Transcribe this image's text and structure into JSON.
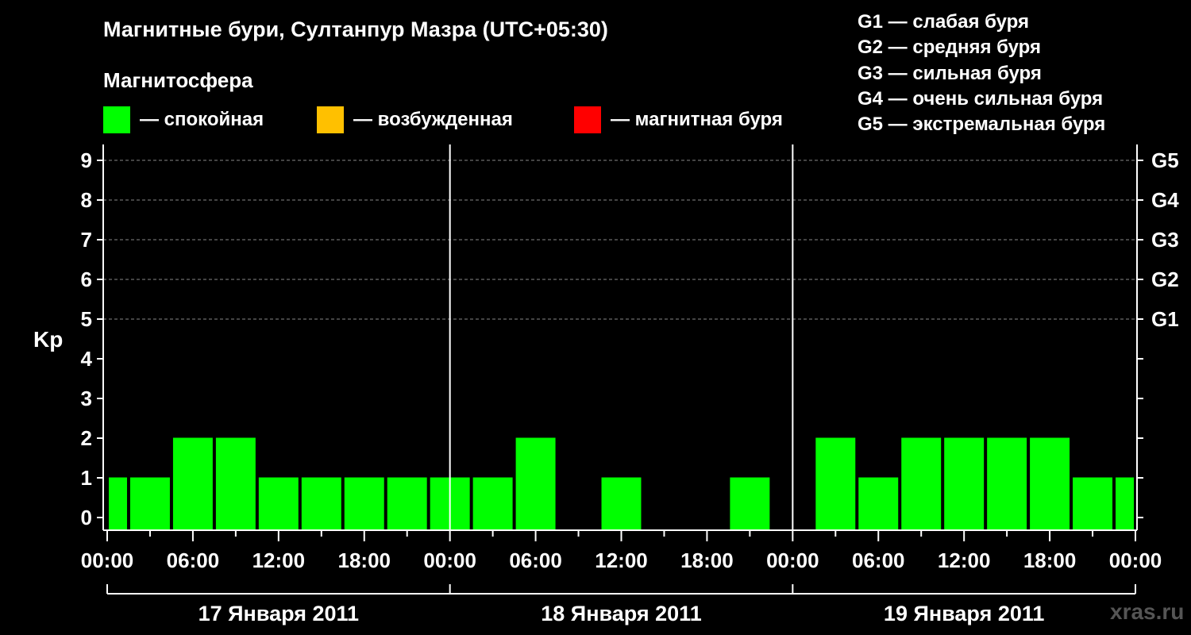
{
  "title": "Магнитные бури, Султанпур Мазра (UTC+05:30)",
  "magnetosphere": {
    "heading": "Магнитосфера",
    "legend": [
      {
        "label": "— спокойная",
        "color": "#00ff00"
      },
      {
        "label": "— возбужденная",
        "color": "#ffc000"
      },
      {
        "label": "— магнитная буря",
        "color": "#ff0000"
      }
    ]
  },
  "g_scale": [
    "G1 — слабая буря",
    "G2 — средняя буря",
    "G3 — сильная буря",
    "G4 — очень сильная буря",
    "G5 — экстремальная буря"
  ],
  "watermark": "xras.ru",
  "chart_data": {
    "type": "bar",
    "title": "Магнитные бури, Султанпур Мазра (UTC+05:30)",
    "ylabel": "Kp",
    "ylim": [
      0,
      9
    ],
    "yticks": [
      "0",
      "1",
      "2",
      "3",
      "4",
      "5",
      "6",
      "7",
      "8",
      "9"
    ],
    "right_ticks": [
      {
        "kp": 5,
        "label": "G1"
      },
      {
        "kp": 6,
        "label": "G2"
      },
      {
        "kp": 7,
        "label": "G3"
      },
      {
        "kp": 8,
        "label": "G4"
      },
      {
        "kp": 9,
        "label": "G5"
      }
    ],
    "xticks": [
      "00:00",
      "06:00",
      "12:00",
      "18:00",
      "00:00",
      "06:00",
      "12:00",
      "18:00",
      "00:00",
      "06:00",
      "12:00",
      "18:00",
      "00:00"
    ],
    "days": [
      "17 Января 2011",
      "18 Января 2011",
      "19 Января 2011"
    ],
    "bar_color": "#00ff00",
    "series": [
      {
        "start_hours": -1.5,
        "values": [
          1,
          1,
          2,
          2,
          1,
          1,
          1,
          1,
          1,
          1,
          2,
          0,
          1,
          0,
          0,
          1,
          0,
          2,
          1,
          2,
          2,
          2,
          2,
          1,
          1
        ]
      }
    ],
    "interval_hours": 3,
    "total_hours": 72,
    "grid": "dashed horizontal at 5-9"
  }
}
